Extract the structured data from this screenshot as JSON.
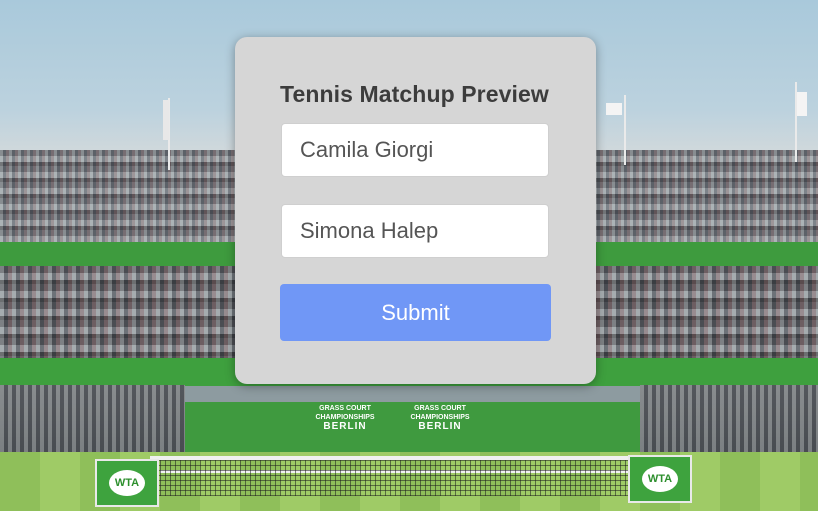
{
  "form": {
    "title": "Tennis Matchup Preview",
    "player1_value": "Camila Giorgi",
    "player2_value": "Simona Halep",
    "submit_label": "Submit"
  },
  "background": {
    "board_logo": "WTA",
    "sponsor_line1": "GRASS COURT",
    "sponsor_line2": "CHAMPIONSHIPS",
    "sponsor_line3": "BERLIN"
  },
  "colors": {
    "card_background": "#d6d6d6",
    "submit_button": "#7097f6",
    "court_green": "#3ea03e"
  }
}
